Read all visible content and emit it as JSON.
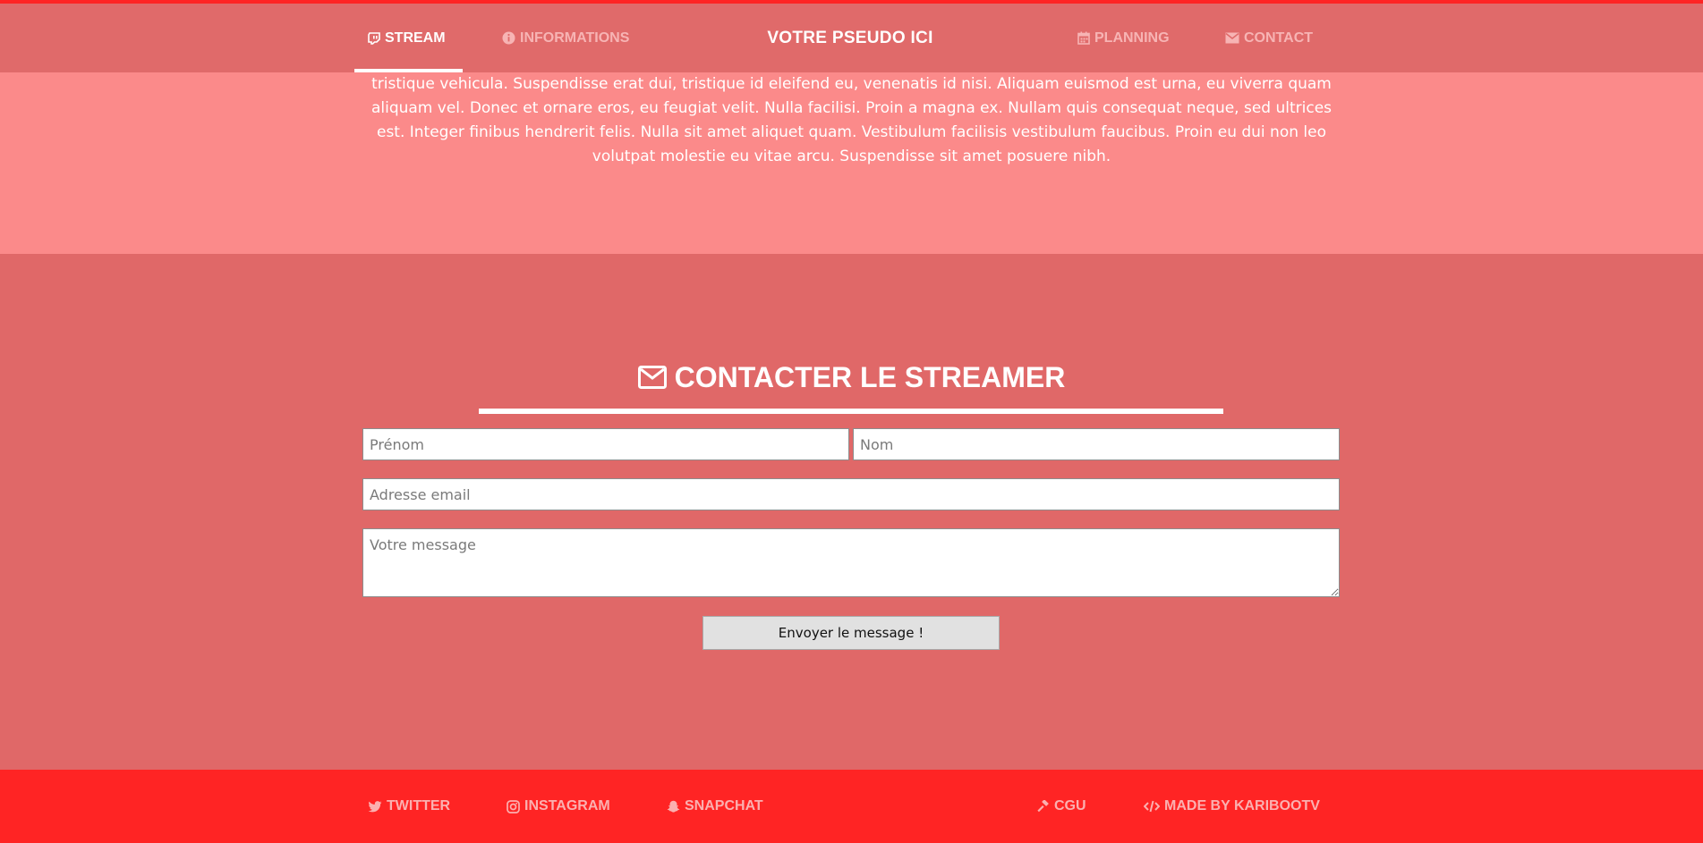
{
  "header": {
    "brand": "VOTRE PSEUDO ICI",
    "nav": {
      "stream": {
        "label": "STREAM",
        "icon": "twitch-icon"
      },
      "informations": {
        "label": "INFORMATIONS",
        "icon": "info-circle-icon"
      },
      "planning": {
        "label": "PLANNING",
        "icon": "calendar-icon"
      },
      "contact": {
        "label": "CONTACT",
        "icon": "envelope-icon"
      }
    },
    "active_tab": "STREAM"
  },
  "intro": {
    "text": "tristique vehicula. Suspendisse erat dui, tristique id eleifend eu, venenatis id nisi. Aliquam euismod est urna, eu viverra quam aliquam vel. Donec et ornare eros, eu feugiat velit. Nulla facilisi. Proin a magna ex. Nullam quis consequat neque, sed ultrices est. Integer finibus hendrerit felis. Nulla sit amet aliquet quam. Vestibulum facilisis vestibulum faucibus. Proin eu dui non leo volutpat molestie eu vitae arcu. Suspendisse sit amet posuere nibh."
  },
  "contact": {
    "title": "CONTACTER LE STREAMER",
    "title_icon": "envelope-icon",
    "firstname_placeholder": "Prénom",
    "lastname_placeholder": "Nom",
    "email_placeholder": "Adresse email",
    "message_placeholder": "Votre message",
    "send_label": "Envoyer le message !"
  },
  "footer": {
    "twitter": {
      "label": "TWITTER",
      "icon": "twitter-icon"
    },
    "instagram": {
      "label": "INSTAGRAM",
      "icon": "instagram-icon"
    },
    "snapchat": {
      "label": "SNAPCHAT",
      "icon": "snapchat-icon"
    },
    "cgu": {
      "label": "CGU",
      "icon": "gavel-icon"
    },
    "made_by": {
      "label": "MADE BY KARIBOOTV",
      "icon": "code-icon"
    }
  },
  "colors": {
    "accent_red": "#ff2424",
    "header_bg": "#e06a6a",
    "intro_bg": "#fb8a8a",
    "section_bg": "#e06868",
    "inactive_text": "#f7b4b4"
  }
}
